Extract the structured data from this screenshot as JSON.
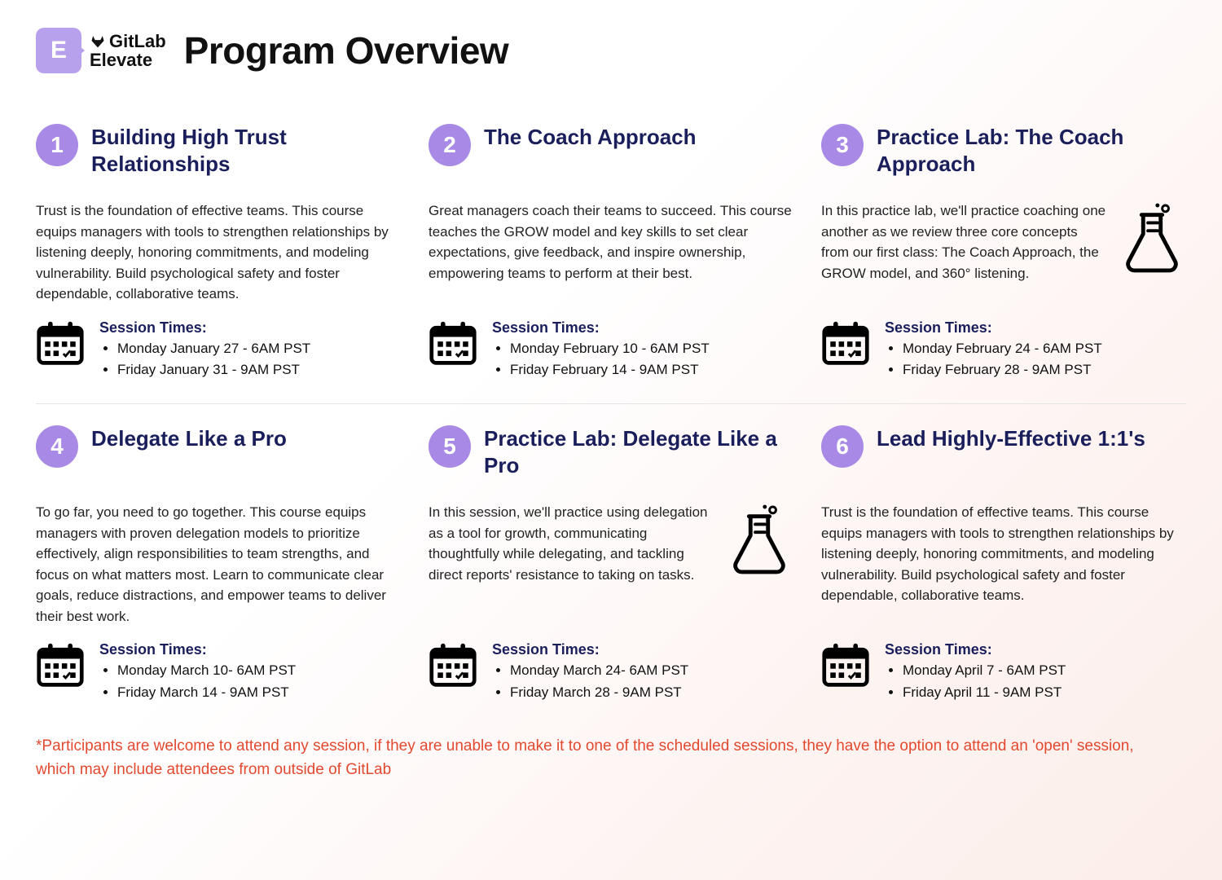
{
  "logo": {
    "badge_letter": "E",
    "brand_top": "GitLab",
    "brand_bottom": "Elevate"
  },
  "page_title": "Program Overview",
  "session_times_label": "Session Times:",
  "modules": [
    {
      "num": "1",
      "title": "Building High Trust Relationships",
      "desc": "Trust is the foundation of effective teams. This course equips managers with tools to strengthen relationships by listening deeply, honoring commitments, and modeling vulnerability. Build psychological safety and foster dependable, collaborative teams.",
      "has_flask": false,
      "times": [
        "Monday January 27 - 6AM PST",
        "Friday January 31 - 9AM PST"
      ]
    },
    {
      "num": "2",
      "title": "The Coach Approach",
      "desc": "Great managers coach their teams to succeed. This course teaches the GROW model and key skills to set clear expectations, give feedback, and inspire ownership, empowering teams to perform at their best.",
      "has_flask": false,
      "times": [
        "Monday February 10 - 6AM PST",
        "Friday February 14 - 9AM PST"
      ]
    },
    {
      "num": "3",
      "title": "Practice Lab: The Coach Approach",
      "desc": "In this practice lab, we'll practice coaching one another as we review three core concepts from our first class: The Coach Approach, the GROW model, and 360° listening.",
      "has_flask": true,
      "times": [
        "Monday February 24 - 6AM PST",
        "Friday February 28 - 9AM PST"
      ]
    },
    {
      "num": "4",
      "title": "Delegate Like a Pro",
      "desc": "To go far, you need to go together. This course equips managers with proven delegation models to prioritize effectively, align responsibilities to team strengths, and focus on what matters most. Learn to communicate clear goals, reduce distractions, and empower teams to deliver their best work.",
      "has_flask": false,
      "times": [
        "Monday March 10- 6AM PST",
        "Friday March 14 - 9AM PST"
      ]
    },
    {
      "num": "5",
      "title": "Practice Lab: Delegate Like a Pro",
      "desc": "In this session, we'll practice using delegation as a tool for growth, communicating thoughtfully while delegating, and tackling direct reports' resistance to taking on tasks.",
      "has_flask": true,
      "times": [
        "Monday March 24- 6AM PST",
        "Friday March 28 - 9AM PST"
      ]
    },
    {
      "num": "6",
      "title": "Lead Highly-Effective 1:1's",
      "desc": "Trust is the foundation of effective teams. This course equips managers with tools to strengthen relationships by listening deeply, honoring commitments, and modeling vulnerability. Build psychological safety and foster dependable, collaborative teams.",
      "has_flask": false,
      "times": [
        "Monday April 7 - 6AM PST",
        "Friday April 11 - 9AM PST"
      ]
    }
  ],
  "footnote": "*Participants are welcome to attend any session, if they are unable to make it to one of the scheduled sessions, they have the option to attend an 'open' session, which may include attendees from outside of GitLab"
}
